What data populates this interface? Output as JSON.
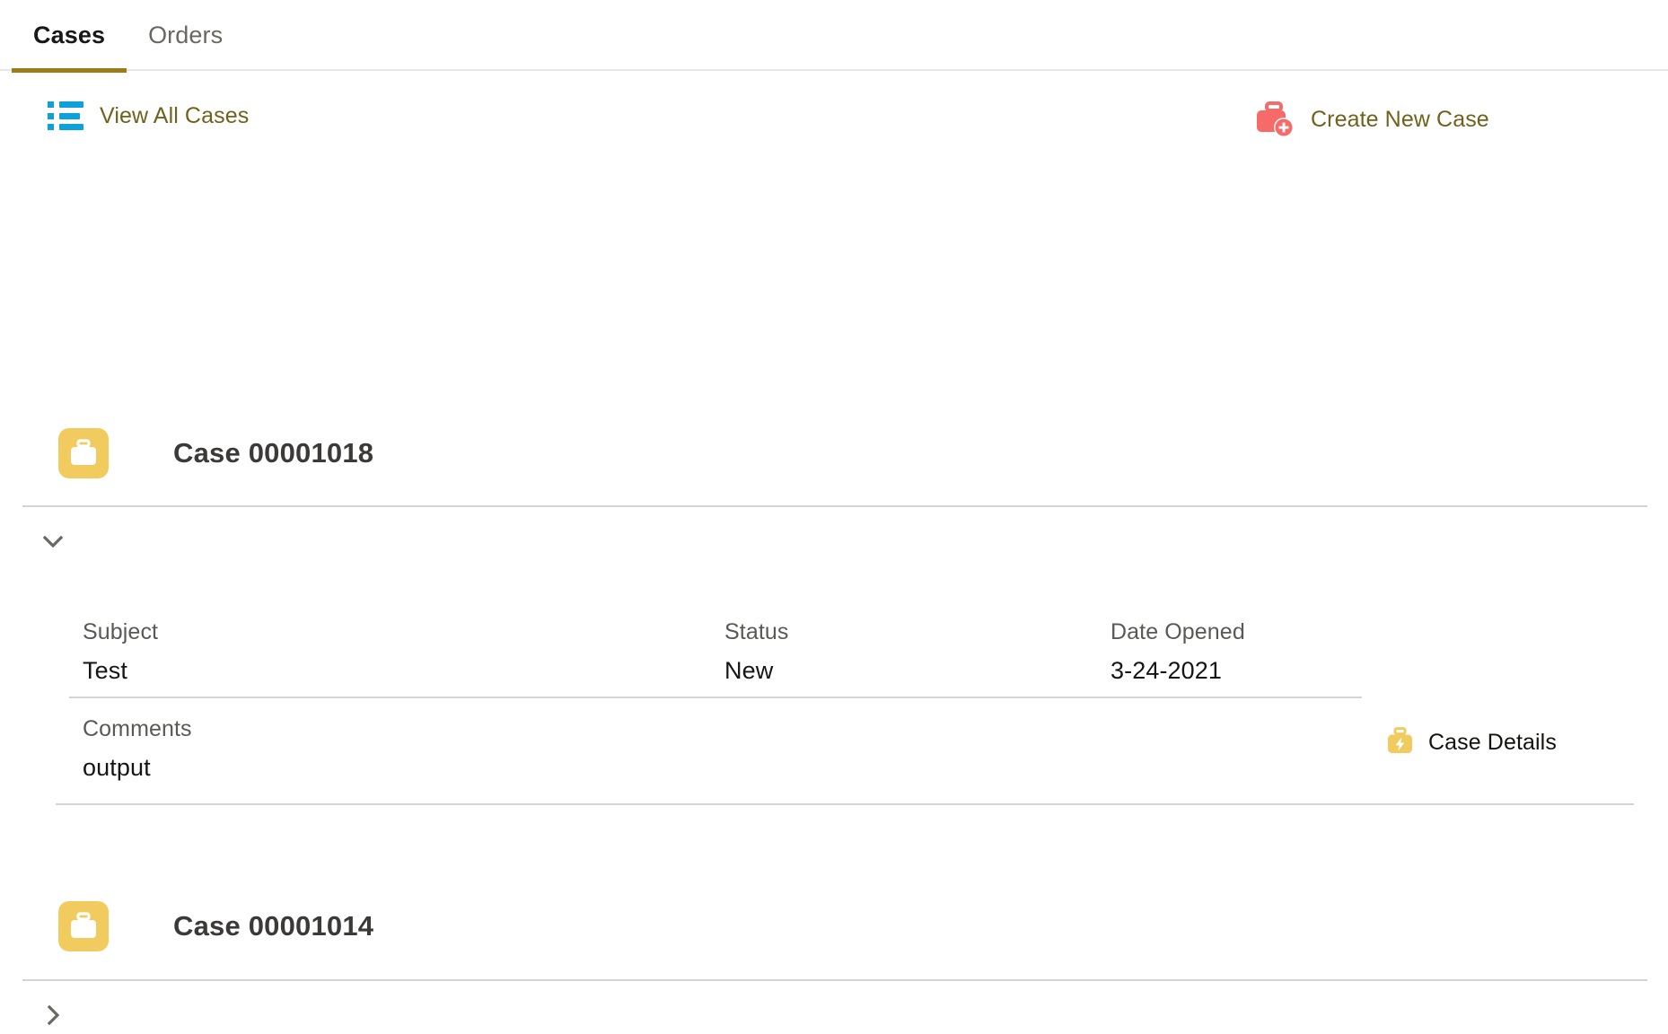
{
  "tabs": [
    {
      "label": "Cases",
      "active": true
    },
    {
      "label": "Orders",
      "active": false
    }
  ],
  "actions": {
    "view_all": {
      "label": "View All Cases",
      "icon": "list-icon",
      "icon_color": "#0ba1dd"
    },
    "create_new": {
      "label": "Create New Case",
      "icon": "briefcase-plus-icon",
      "icon_color": "#f76a6a"
    }
  },
  "colors": {
    "accent_underline": "#9c7c17",
    "link_text": "#70621c",
    "case_badge": "#f2cb5f",
    "divider": "#d4d4d4"
  },
  "cases": [
    {
      "title": "Case 00001018",
      "expanded": true,
      "toggle_icon": "chevron-down-icon",
      "fields": [
        {
          "label": "Subject",
          "value": "Test"
        },
        {
          "label": "Status",
          "value": "New"
        },
        {
          "label": "Date Opened",
          "value": "3-24-2021"
        }
      ],
      "comments": {
        "label": "Comments",
        "value": "output"
      },
      "detail_link": {
        "label": "Case Details",
        "icon": "briefcase-bolt-icon"
      }
    },
    {
      "title": "Case 00001014",
      "expanded": false,
      "toggle_icon": "chevron-right-icon"
    }
  ]
}
